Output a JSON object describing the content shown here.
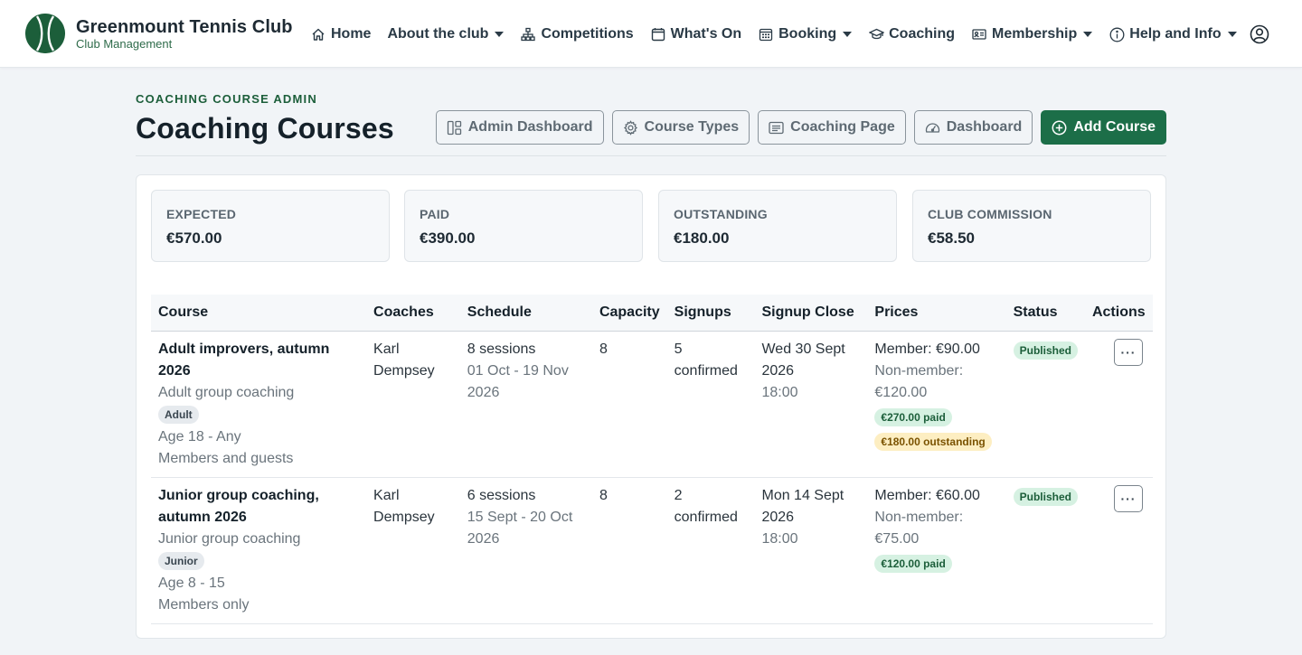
{
  "brand": {
    "title": "Greenmount Tennis Club",
    "subtitle": "Club Management"
  },
  "nav": [
    {
      "label": "Home",
      "icon": "home-icon",
      "caret": false
    },
    {
      "label": "About the club",
      "icon": "",
      "caret": true
    },
    {
      "label": "Competitions",
      "icon": "sitemap-icon",
      "caret": false
    },
    {
      "label": "What's On",
      "icon": "calendar-icon",
      "caret": false
    },
    {
      "label": "Booking",
      "icon": "calendar-grid-icon",
      "caret": true
    },
    {
      "label": "Coaching",
      "icon": "graduation-cap-icon",
      "caret": false
    },
    {
      "label": "Membership",
      "icon": "id-card-icon",
      "caret": true
    },
    {
      "label": "Help and Info",
      "icon": "info-icon",
      "caret": true
    }
  ],
  "page": {
    "eyebrow": "COACHING COURSE ADMIN",
    "title": "Coaching Courses"
  },
  "actions": {
    "admin_dashboard": "Admin Dashboard",
    "course_types": "Course Types",
    "coaching_page": "Coaching Page",
    "dashboard": "Dashboard",
    "add_course": "Add Course"
  },
  "stats": [
    {
      "label": "EXPECTED",
      "value": "€570.00"
    },
    {
      "label": "PAID",
      "value": "€390.00"
    },
    {
      "label": "OUTSTANDING",
      "value": "€180.00"
    },
    {
      "label": "CLUB COMMISSION",
      "value": "€58.50"
    }
  ],
  "table": {
    "headers": [
      "Course",
      "Coaches",
      "Schedule",
      "Capacity",
      "Signups",
      "Signup Close",
      "Prices",
      "Status",
      "Actions"
    ],
    "rows": [
      {
        "name": "Adult improvers, autumn 2026",
        "type": "Adult group coaching",
        "tag": "Adult",
        "age": "Age 18 - Any",
        "audience": "Members and guests",
        "coach": "Karl Dempsey",
        "sessions": "8 sessions",
        "dates": "01 Oct - 19 Nov 2026",
        "capacity": "8",
        "signups": "5 confirmed",
        "close_date": "Wed 30 Sept 2026",
        "close_time": "18:00",
        "member_price": "Member: €90.00",
        "nonmember_price": "Non-member: €120.00",
        "paid": "€270.00 paid",
        "outstanding": "€180.00 outstanding",
        "status": "Published",
        "action": "···"
      },
      {
        "name": "Junior group coaching, autumn 2026",
        "type": "Junior group coaching",
        "tag": "Junior",
        "age": "Age 8 - 15",
        "audience": "Members only",
        "coach": "Karl Dempsey",
        "sessions": "6 sessions",
        "dates": "15 Sept - 20 Oct 2026",
        "capacity": "8",
        "signups": "2 confirmed",
        "close_date": "Mon 14 Sept 2026",
        "close_time": "18:00",
        "member_price": "Member: €60.00",
        "nonmember_price": "Non-member: €75.00",
        "paid": "€120.00 paid",
        "status": "Published",
        "action": "···"
      }
    ]
  },
  "colors": {
    "brand_green": "#1c5e3a",
    "primary_button": "#1c6e48",
    "paid_bg": "#d6f1e2",
    "outstanding_bg": "#fdeec2"
  }
}
